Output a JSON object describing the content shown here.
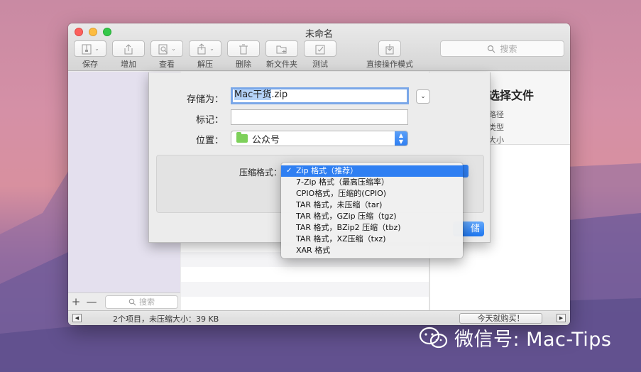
{
  "window": {
    "title": "未命名"
  },
  "toolbar": {
    "buttons": [
      {
        "label": "保存",
        "icon": "archive-icon"
      },
      {
        "label": "增加",
        "icon": "add-files-icon"
      },
      {
        "label": "查看",
        "icon": "preview-icon"
      },
      {
        "label": "解压",
        "icon": "extract-icon"
      },
      {
        "label": "删除",
        "icon": "trash-icon"
      },
      {
        "label": "新文件夹",
        "icon": "new-folder-icon"
      },
      {
        "label": "测试",
        "icon": "test-icon"
      },
      {
        "label": "直接操作模式",
        "icon": "direct-mode-icon"
      }
    ],
    "search_placeholder": "搜索"
  },
  "sidebar": {
    "add": "+",
    "remove": "—",
    "search_placeholder": "搜索"
  },
  "info": {
    "title": "选择文件",
    "lines": [
      "路径",
      "类型",
      "大小"
    ]
  },
  "status": {
    "text": "2个项目，未压缩大小：39 KB",
    "buy": "今天就购买！"
  },
  "save_sheet": {
    "save_as_label": "存储为：",
    "filename_selected": "Mac干货",
    "filename_ext": ".zip",
    "tags_label": "标记：",
    "location_label": "位置：",
    "location_value": "公众号",
    "format_label": "压缩格式：",
    "save_button_partial": "储"
  },
  "format_menu": {
    "items": [
      {
        "label": "Zip 格式（推荐）",
        "selected": true
      },
      {
        "label": "7-Zip 格式（最高压缩率）",
        "selected": false
      },
      {
        "label": "CPIO格式，压缩的(CPIO)",
        "selected": false
      },
      {
        "label": "TAR 格式，未压缩（tar)",
        "selected": false
      },
      {
        "label": "TAR 格式，GZip 压缩（tgz)",
        "selected": false
      },
      {
        "label": "TAR 格式，BZip2 压缩（tbz)",
        "selected": false
      },
      {
        "label": "TAR 格式，XZ压缩（txz)",
        "selected": false
      },
      {
        "label": "XAR 格式",
        "selected": false
      }
    ],
    "check": "✓"
  },
  "watermark": {
    "text": "微信号: Mac-Tips"
  },
  "colors": {
    "accent": "#2f7ff2",
    "close": "#fc605c",
    "minimize": "#fdbc40",
    "maximize": "#34c84a",
    "folder": "#7dd05a"
  }
}
